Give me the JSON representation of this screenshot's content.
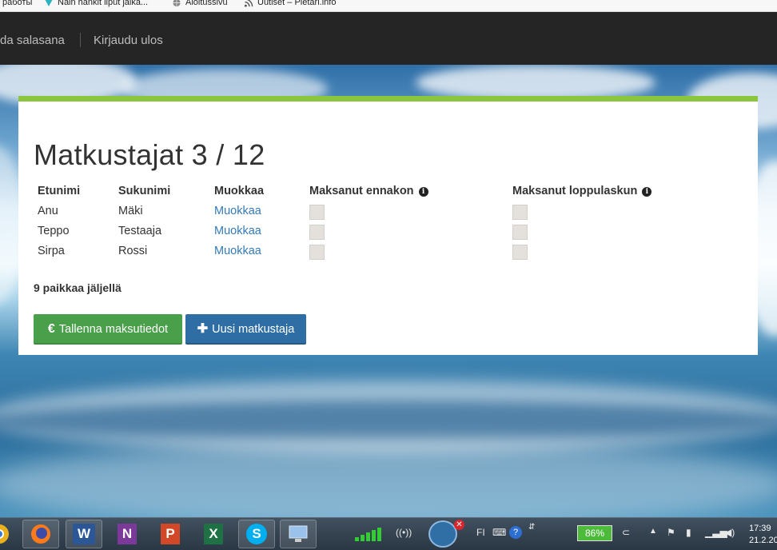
{
  "bookmarks": [
    {
      "label": "работы",
      "icon": "none"
    },
    {
      "label": "Näin hankit liput jalka...",
      "icon": "bookmark-icon"
    },
    {
      "label": "Aloitussivu",
      "icon": "globe-icon"
    },
    {
      "label": "Uutiset – Pietari.info",
      "icon": "rss-icon"
    }
  ],
  "nav": {
    "change_password": "da salasana",
    "logout": "Kirjaudu ulos"
  },
  "page": {
    "title": "Matkustajat 3 / 12",
    "remaining": "9 paikkaa jäljellä"
  },
  "table": {
    "headers": [
      "Etunimi",
      "Sukunimi",
      "Muokkaa",
      "Maksanut ennakon",
      "Maksanut loppulaskun"
    ],
    "rows": [
      {
        "first": "Anu",
        "last": "Mäki",
        "edit": "Muokkaa",
        "prepaid": false,
        "final_paid": false
      },
      {
        "first": "Teppo",
        "last": "Testaaja",
        "edit": "Muokkaa",
        "prepaid": false,
        "final_paid": false
      },
      {
        "first": "Sirpa",
        "last": "Rossi",
        "edit": "Muokkaa",
        "prepaid": false,
        "final_paid": false
      }
    ]
  },
  "buttons": {
    "save": "Tallenna maksutiedot",
    "save_icon": "€",
    "new": "Uusi matkustaja",
    "new_icon": "✚"
  },
  "colors": {
    "accent_green": "#8cc63f",
    "save_button": "#4aa04a",
    "new_button": "#2f6ea5",
    "link": "#337ab7"
  },
  "taskbar": {
    "apps": [
      "chrome-icon",
      "firefox-icon",
      "word-icon",
      "onenote-icon",
      "powerpoint-icon",
      "excel-icon",
      "skype-icon",
      "remote-desktop-icon"
    ],
    "app_letters": {
      "word": "W",
      "onenote": "N",
      "powerpoint": "P",
      "excel": "X",
      "skype": "S"
    },
    "language": "FI",
    "battery": "86%",
    "time": "17:39",
    "date": "21.2.20"
  }
}
